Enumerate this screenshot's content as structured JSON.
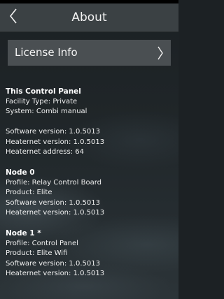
{
  "header": {
    "title": "About",
    "back_icon": "chevron-left-icon"
  },
  "license": {
    "label": "License Info",
    "icon": "chevron-right-icon"
  },
  "this_panel": {
    "title": "This Control Panel",
    "facility_type": "Facility Type: Private",
    "system": "System: Combi manual",
    "software_version": "Software version: 1.0.5013",
    "heaternet_version": "Heaternet version: 1.0.5013",
    "heaternet_address": "Heaternet address: 64"
  },
  "node0": {
    "title": "Node 0",
    "profile": "Profile: Relay Control Board",
    "product": "Product: Elite",
    "software_version": "Software version: 1.0.5013",
    "heaternet_version": "Heaternet version: 1.0.5013"
  },
  "node1": {
    "title": "Node 1 *",
    "profile": "Profile: Control Panel",
    "product": "Product: Elite Wifi",
    "software_version": "Software version: 1.0.5013",
    "heaternet_version": "Heaternet version: 1.0.5013"
  },
  "colors": {
    "header_bg": "#3b4144",
    "row_bg": "#4a4f52",
    "text": "#ffffff"
  }
}
